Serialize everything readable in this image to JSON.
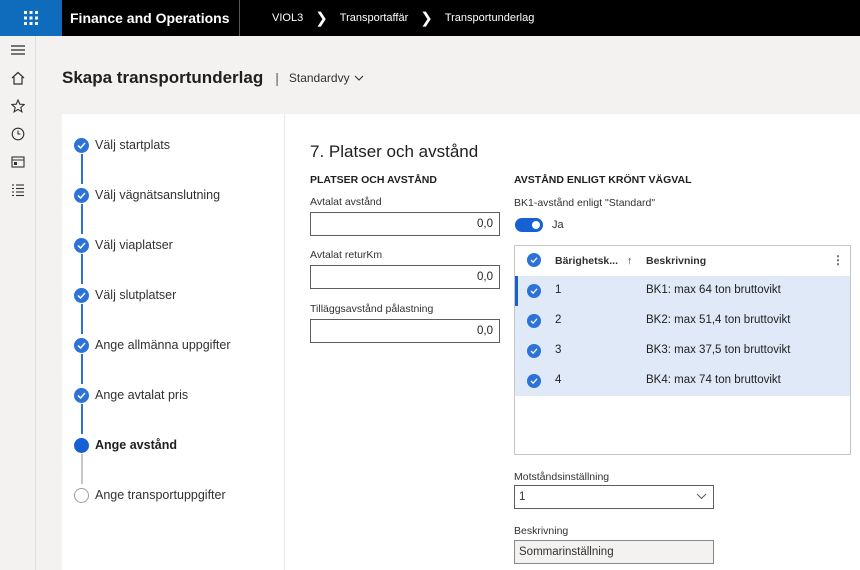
{
  "topbar": {
    "app_title": "Finance and Operations",
    "breadcrumbs": [
      "VIOL3",
      "Transportaffär",
      "Transportunderlag"
    ]
  },
  "leftnav": {
    "icons": [
      "hamburger-icon",
      "home-icon",
      "star-icon",
      "clock-icon",
      "workspace-icon",
      "list-icon"
    ]
  },
  "header": {
    "title": "Skapa transportunderlag",
    "view": "Standardvy"
  },
  "steps": [
    {
      "label": "Välj startplats",
      "state": "done"
    },
    {
      "label": "Välj vägnätsanslutning",
      "state": "done"
    },
    {
      "label": "Välj viaplatser",
      "state": "done"
    },
    {
      "label": "Välj slutplatser",
      "state": "done"
    },
    {
      "label": "Ange allmänna uppgifter",
      "state": "done"
    },
    {
      "label": "Ange avtalat pris",
      "state": "done"
    },
    {
      "label": "Ange avstånd",
      "state": "current"
    },
    {
      "label": "Ange transportuppgifter",
      "state": "todo"
    }
  ],
  "form": {
    "section_title": "7. Platser och avstånd",
    "left_group_title": "PLATSER OCH AVSTÅND",
    "fields": [
      {
        "label": "Avtalat avstånd",
        "value": "0,0"
      },
      {
        "label": "Avtalat returKm",
        "value": "0,0"
      },
      {
        "label": "Tilläggsavstånd pålastning",
        "value": "0,0"
      }
    ],
    "right_group_title": "AVSTÅND ENLIGT KRÖNT VÄGVAL",
    "toggle_label": "BK1-avstånd enligt \"Standard\"",
    "toggle_value": "Ja",
    "toggle_on": true,
    "grid": {
      "columns": [
        "Bärighetsk...",
        "Beskrivning"
      ],
      "sort_indicator": "↑",
      "rows": [
        {
          "code": "1",
          "desc": "BK1: max 64 ton bruttovikt"
        },
        {
          "code": "2",
          "desc": "BK2: max 51,4 ton bruttovikt"
        },
        {
          "code": "3",
          "desc": "BK3: max 37,5 ton bruttovikt"
        },
        {
          "code": "4",
          "desc": "BK4: max 74 ton bruttovikt"
        }
      ]
    },
    "resistance_label": "Motståndsinställning",
    "resistance_value": "1",
    "description_label": "Beskrivning",
    "description_value": "Sommarinställning"
  },
  "colors": {
    "accent": "#1661d1",
    "topbar": "#000000",
    "waffle": "#0f6cbd",
    "selected_row": "#dfe9f7"
  }
}
